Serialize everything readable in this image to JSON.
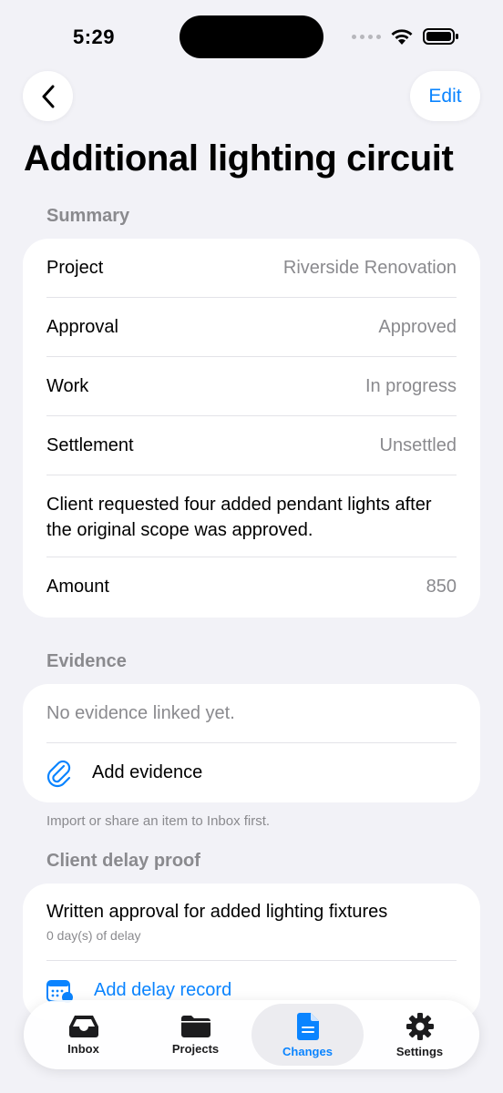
{
  "status_bar": {
    "time": "5:29"
  },
  "nav": {
    "edit_label": "Edit",
    "title": "Additional lighting circuit"
  },
  "summary": {
    "header": "Summary",
    "rows": [
      {
        "label": "Project",
        "value": "Riverside Renovation"
      },
      {
        "label": "Approval",
        "value": "Approved"
      },
      {
        "label": "Work",
        "value": "In progress"
      },
      {
        "label": "Settlement",
        "value": "Unsettled"
      }
    ],
    "description": "Client requested four added pendant lights after the original scope was approved.",
    "amount_label": "Amount",
    "amount_value": "850"
  },
  "evidence": {
    "header": "Evidence",
    "empty_text": "No evidence linked yet.",
    "add_label": "Add evidence",
    "footer": "Import or share an item to Inbox first."
  },
  "delay_proof": {
    "header": "Client delay proof",
    "item_title": "Written approval for added lighting fixtures",
    "item_subtitle": "0 day(s) of delay",
    "add_label": "Add delay record"
  },
  "tabs": [
    {
      "label": "Inbox",
      "icon": "inbox-tray-icon"
    },
    {
      "label": "Projects",
      "icon": "folder-icon"
    },
    {
      "label": "Changes",
      "icon": "document-icon"
    },
    {
      "label": "Settings",
      "icon": "gear-icon"
    }
  ],
  "colors": {
    "accent": "#0a84ff",
    "background": "#f2f2f7",
    "secondary_text": "#8a8a8e"
  }
}
